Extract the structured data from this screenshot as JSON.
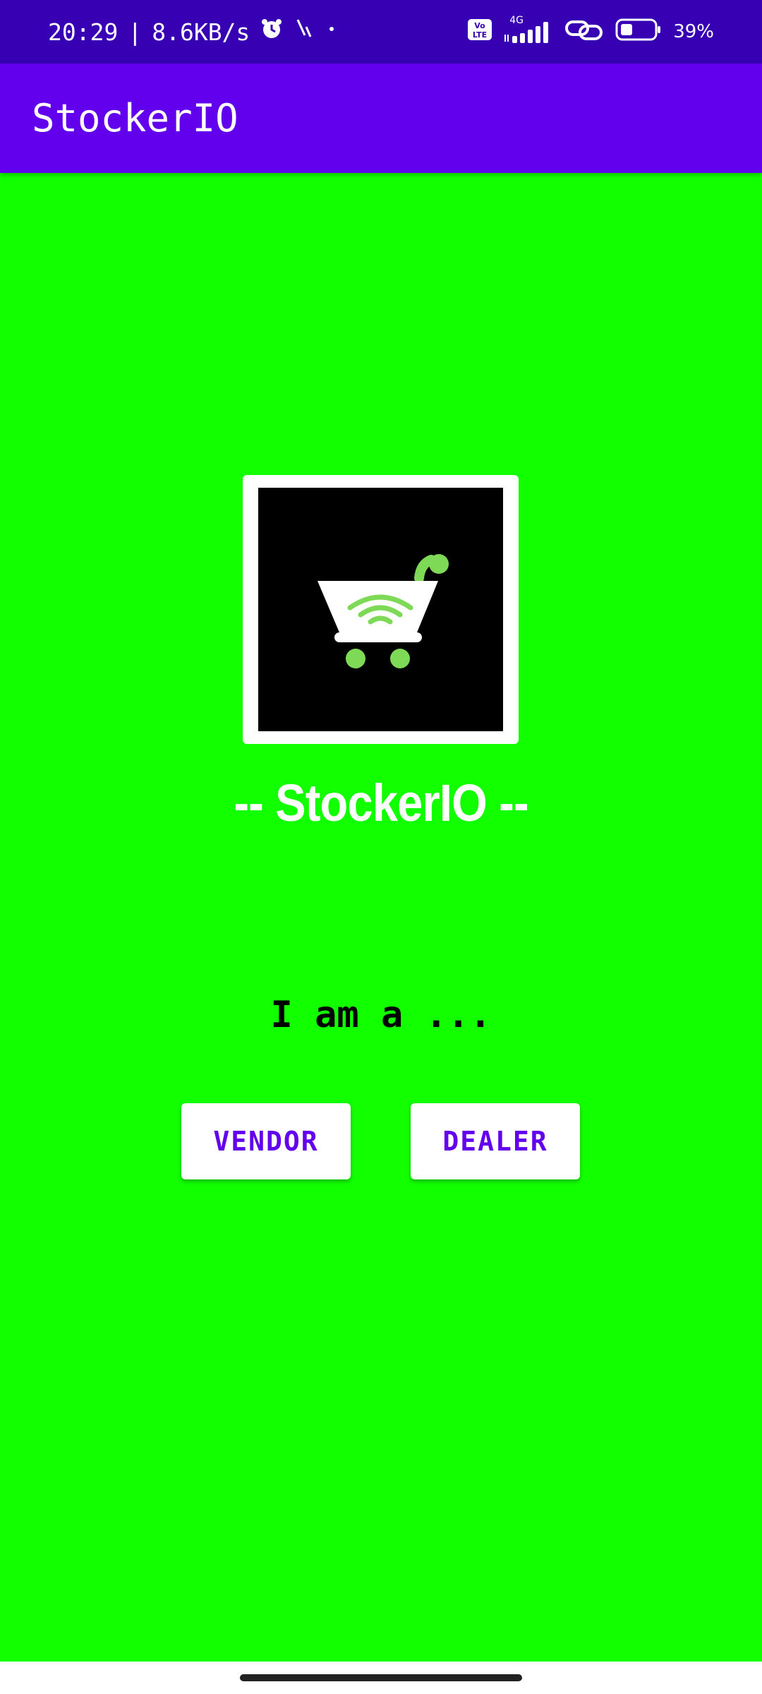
{
  "status_bar": {
    "time": "20:29",
    "separator": "|",
    "network_speed": "8.6KB/s",
    "network_type": "4G",
    "volte": "Vo LTE",
    "battery": "39%",
    "icons": [
      "alarm-icon",
      "activity-icon",
      "dot-icon",
      "volte-icon",
      "signal-icon",
      "link-icon",
      "battery-icon"
    ]
  },
  "app_bar": {
    "title": "StockerIO"
  },
  "logo": {
    "icon": "shopping-cart-wifi-icon"
  },
  "brand": {
    "name": "-- StockerIO --"
  },
  "prompt": {
    "text": "I am a ..."
  },
  "buttons": {
    "vendor": "VENDOR",
    "dealer": "DEALER"
  },
  "colors": {
    "background": "#12ff00",
    "status_bar": "#3700b3",
    "app_bar": "#6200ee",
    "accent": "#6200ee",
    "logo_green": "#7ed957"
  }
}
